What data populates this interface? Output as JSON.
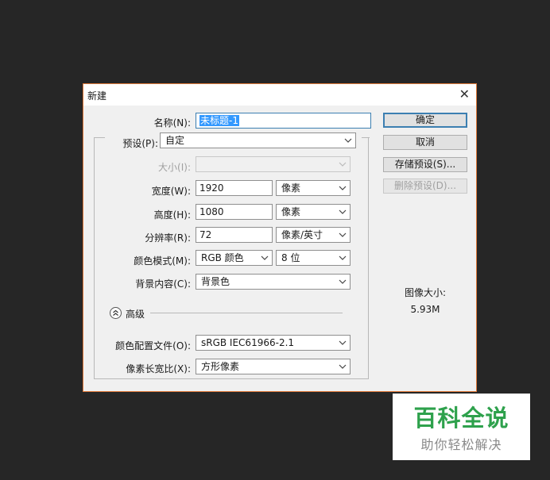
{
  "dialog": {
    "title": "新建",
    "close": "✕",
    "name_label": "名称(N):",
    "name_value": "未标题-1",
    "preset_label": "预设(P):",
    "preset_value": "自定",
    "size_label": "大小(I):",
    "size_value": "",
    "width_label": "宽度(W):",
    "width_value": "1920",
    "width_unit": "像素",
    "height_label": "高度(H):",
    "height_value": "1080",
    "height_unit": "像素",
    "resolution_label": "分辨率(R):",
    "resolution_value": "72",
    "resolution_unit": "像素/英寸",
    "color_mode_label": "颜色模式(M):",
    "color_mode_value": "RGB 颜色",
    "bit_depth_value": "8 位",
    "background_label": "背景内容(C):",
    "background_value": "背景色",
    "advanced_label": "高级",
    "color_profile_label": "颜色配置文件(O):",
    "color_profile_value": "sRGB IEC61966-2.1",
    "pixel_aspect_label": "像素长宽比(X):",
    "pixel_aspect_value": "方形像素"
  },
  "buttons": {
    "ok": "确定",
    "cancel": "取消",
    "save_preset": "存储预设(S)...",
    "delete_preset": "删除预设(D)..."
  },
  "image_size": {
    "label": "图像大小:",
    "value": "5.93M"
  },
  "watermark": {
    "title": "百科全说",
    "subtitle": "助你轻松解决"
  }
}
